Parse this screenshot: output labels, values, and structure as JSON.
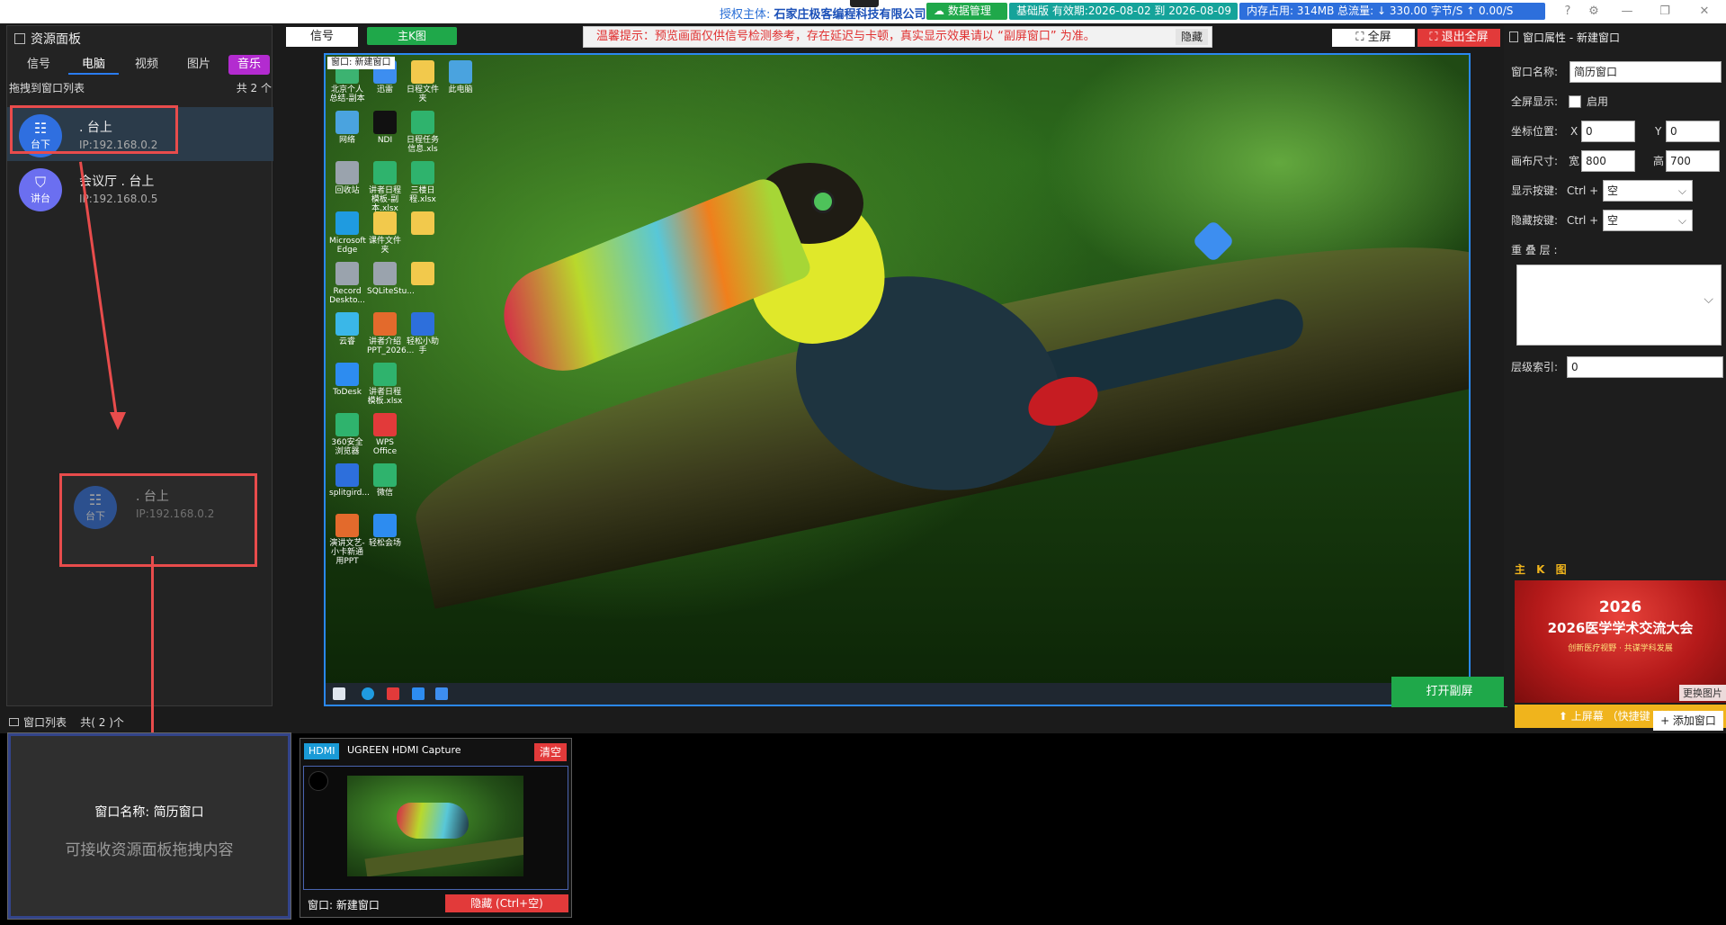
{
  "topbar": {
    "license_label": "授权主体: ",
    "license_company": "石家庄极客编程科技有限公司",
    "data_mgmt": "数据管理",
    "edition": "基础版 有效期:2026-08-02 到 2026-08-09",
    "stats": "内存占用: 314MB  总流量: ↓ 330.00 字节/S  ↑ 0.00/S",
    "help_icon": "?",
    "settings_icon": "⚙",
    "minimize": "—",
    "restore": "❐",
    "close": "✕"
  },
  "left_panel": {
    "title": "资源面板",
    "tabs": [
      {
        "label": "信号"
      },
      {
        "label": "电脑"
      },
      {
        "label": "视频"
      },
      {
        "label": "图片"
      },
      {
        "label": "音乐"
      }
    ],
    "drag_hint": "拖拽到窗口列表",
    "count": "共 2 个",
    "items": [
      {
        "name": ". 台上",
        "ip": "IP:192.168.0.2",
        "badge": "台下",
        "icon": "grid-icon"
      },
      {
        "name": "会议厅 . 台上",
        "ip": "IP:192.168.0.5",
        "badge": "讲台",
        "icon": "podium-icon"
      }
    ]
  },
  "center": {
    "signal_btn": "信号",
    "kmap_btn": "主K图",
    "notice": "温馨提示：预览画面仅供信号检测参考，存在延迟与卡顿，真实显示效果请以 “副屏窗口” 为准。",
    "notice_hide": "隐藏",
    "fullscreen": "⛶ 全屏",
    "exit_fullscreen": "⛶ 退出全屏",
    "preview_label": "窗口: 新建窗口",
    "open_subscreen": "打开副屏",
    "desktop_icons": [
      {
        "label": "北京个人总结-副本",
        "color": "#3cb371"
      },
      {
        "label": "迅雷",
        "color": "#3d8ef0"
      },
      {
        "label": "日程文件夹",
        "color": "#f2c94c"
      },
      {
        "label": "此电脑",
        "color": "#4aa3df"
      },
      {
        "label": "网络",
        "color": "#4aa3df"
      },
      {
        "label": "NDI",
        "color": "#111111"
      },
      {
        "label": "日程任务信息.xls",
        "color": "#2fb36d"
      },
      {
        "label": "回收站",
        "color": "#9aa3ad"
      },
      {
        "label": "讲者日程模板-副本.xlsx",
        "color": "#2fb36d"
      },
      {
        "label": "三楼日程.xlsx",
        "color": "#2fb36d"
      },
      {
        "label": "Microsoft Edge",
        "color": "#1f9be0"
      },
      {
        "label": "课件文件夹",
        "color": "#f2c94c"
      },
      {
        "label": "",
        "color": "#f2c94c"
      },
      {
        "label": "Record Deskto...",
        "color": "#9aa3ad"
      },
      {
        "label": "SQLiteStu...",
        "color": "#9aa3ad"
      },
      {
        "label": "",
        "color": "#f2c94c"
      },
      {
        "label": "云睿",
        "color": "#3ab7e8"
      },
      {
        "label": "讲者介绍PPT_2026...",
        "color": "#e36a2c"
      },
      {
        "label": "轻松小助手",
        "color": "#2d6fdc"
      },
      {
        "label": "ToDesk",
        "color": "#2d8cf0"
      },
      {
        "label": "讲者日程模板.xlsx",
        "color": "#2fb36d"
      },
      {
        "label": "360安全浏览器",
        "color": "#2fb36d"
      },
      {
        "label": "WPS Office",
        "color": "#e23a3a"
      },
      {
        "label": "splitgird...",
        "color": "#2d6fdc"
      },
      {
        "label": "微信",
        "color": "#2fb36d"
      },
      {
        "label": "演讲文艺-小卡新通用PPT",
        "color": "#e36a2c"
      },
      {
        "label": "轻松会场",
        "color": "#2d8cf0"
      }
    ]
  },
  "right_panel": {
    "title": "窗口属性 - 新建窗口",
    "window_name_label": "窗口名称:",
    "window_name_value": "简历窗口",
    "fullscreen_label": "全屏显示:",
    "enable_label": "启用",
    "coord_label": "坐标位置:",
    "x_label": "X",
    "x_value": "0",
    "y_label": "Y",
    "y_value": "0",
    "canvas_label": "画布尺寸:",
    "w_label": "宽",
    "w_value": "800",
    "h_label": "高",
    "h_value": "700",
    "show_key_label": "显示按键:",
    "show_key_mod": "Ctrl +",
    "show_key_value": "空",
    "hide_key_label": "隐藏按键:",
    "hide_key_mod": "Ctrl +",
    "hide_key_value": "空",
    "overlay_label": "重 叠 层 :",
    "z_index_label": "层级索引:",
    "z_index_value": "0",
    "kmap_title": "主 K 图",
    "kmap_year": "2026",
    "kmap_event": "2026医学学术交流大会",
    "kmap_sub": "创新医疗视野 · 共谋学科发展",
    "change_image": "更换图片",
    "upscreen": "⬆ 上屏幕 （快捷键 0键）"
  },
  "window_list": {
    "label": "窗口列表",
    "count": "共( 2 )个",
    "add_window": "+ 添加窗口",
    "card": {
      "name": "窗口名称: 简历窗口",
      "hint": "可接收资源面板拖拽内容"
    },
    "signal_card": {
      "tag": "HDMI",
      "device": "UGREEN HDMI Capture",
      "clear": "清空",
      "window": "窗口: 新建窗口",
      "hide": "隐藏 (Ctrl+空)"
    }
  }
}
